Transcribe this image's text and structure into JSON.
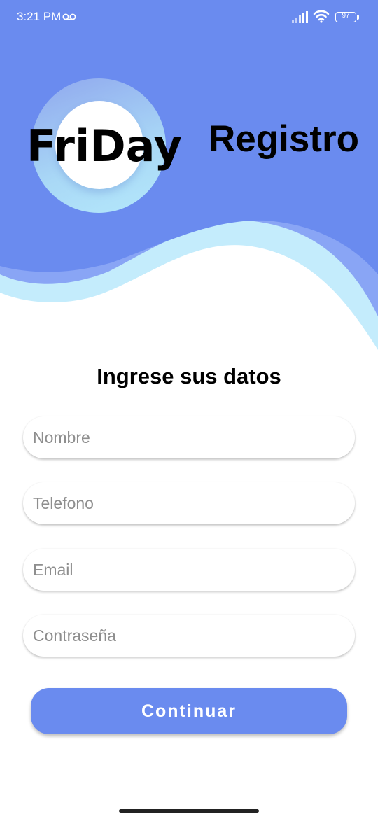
{
  "status_bar": {
    "time": "3:21 PM",
    "battery_level": "97",
    "icons": [
      "voicemail-icon",
      "signal-icon",
      "wifi-icon",
      "battery-icon"
    ]
  },
  "header": {
    "logo_text": "FriDay",
    "title": "Registro"
  },
  "form": {
    "heading": "Ingrese sus datos",
    "fields": [
      {
        "name": "nombre",
        "placeholder": "Nombre",
        "value": ""
      },
      {
        "name": "telefono",
        "placeholder": "Telefono",
        "value": ""
      },
      {
        "name": "email",
        "placeholder": "Email",
        "value": ""
      },
      {
        "name": "contrasena",
        "placeholder": "Contraseña",
        "value": ""
      }
    ],
    "submit_label": "Continuar"
  },
  "colors": {
    "primary": "#6a8bef",
    "wave_accent": "#c5ecfc",
    "background": "#ffffff"
  }
}
